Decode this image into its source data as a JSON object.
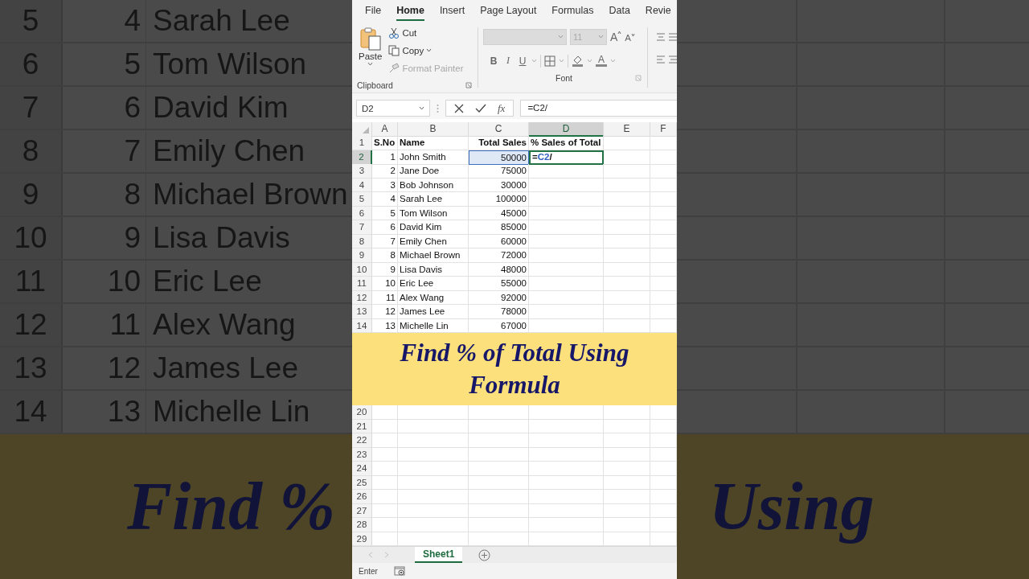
{
  "backdrop": {
    "rows": [
      {
        "row": "5",
        "sno": "4",
        "name": "Sarah Lee"
      },
      {
        "row": "6",
        "sno": "5",
        "name": "Tom Wilson"
      },
      {
        "row": "7",
        "sno": "6",
        "name": "David Kim"
      },
      {
        "row": "8",
        "sno": "7",
        "name": "Emily Chen"
      },
      {
        "row": "9",
        "sno": "8",
        "name": "Michael Brown"
      },
      {
        "row": "10",
        "sno": "9",
        "name": "Lisa Davis"
      },
      {
        "row": "11",
        "sno": "10",
        "name": "Eric Lee"
      },
      {
        "row": "12",
        "sno": "11",
        "name": "Alex Wang"
      },
      {
        "row": "13",
        "sno": "12",
        "name": "James Lee"
      },
      {
        "row": "14",
        "sno": "13",
        "name": "Michelle Lin"
      }
    ],
    "banner_left": "Find %",
    "banner_right": "Using"
  },
  "ribbon": {
    "tabs": [
      {
        "label": "File",
        "selected": false
      },
      {
        "label": "Home",
        "selected": true
      },
      {
        "label": "Insert",
        "selected": false
      },
      {
        "label": "Page Layout",
        "selected": false
      },
      {
        "label": "Formulas",
        "selected": false
      },
      {
        "label": "Data",
        "selected": false
      },
      {
        "label": "Revie",
        "selected": false
      }
    ],
    "clipboard": {
      "paste": "Paste",
      "items": [
        {
          "kind": "cut",
          "label": "Cut",
          "disabled": false
        },
        {
          "kind": "copy",
          "label": "Copy",
          "disabled": false
        },
        {
          "kind": "painter",
          "label": "Format Painter",
          "disabled": true
        }
      ],
      "group_label": "Clipboard"
    },
    "font": {
      "size": "11",
      "grow": "A",
      "shrink": "A",
      "bold": "B",
      "italic": "I",
      "underline": "U",
      "font_color": "A",
      "group_label": "Font"
    }
  },
  "formula_bar": {
    "name_box": "D2",
    "fx": "fx",
    "formula": "=C2/"
  },
  "sheet": {
    "columns": [
      {
        "letter": "A",
        "selected": false
      },
      {
        "letter": "B",
        "selected": false
      },
      {
        "letter": "C",
        "selected": false
      },
      {
        "letter": "D",
        "selected": true
      },
      {
        "letter": "E",
        "selected": false
      },
      {
        "letter": "F",
        "selected": false
      }
    ],
    "rows": [
      {
        "header": "1",
        "selected": false,
        "kind": "header",
        "cells": [
          {
            "text": "S.No",
            "kind": "text"
          },
          {
            "text": "Name",
            "kind": "text"
          },
          {
            "text": "Total Sales",
            "kind": "rightlabel"
          },
          {
            "text": "% Sales of Total",
            "kind": "text"
          }
        ]
      },
      {
        "header": "2",
        "selected": true,
        "kind": "data",
        "cells": [
          {
            "text": "1",
            "kind": "number"
          },
          {
            "text": "John Smith",
            "kind": "text"
          },
          {
            "text": "50000",
            "kind": "reference"
          },
          {
            "parts": [
              {
                "text": "=",
                "kind": "plain"
              },
              {
                "text": "C2",
                "kind": "reference"
              },
              {
                "text": "/",
                "kind": "plain"
              }
            ],
            "kind": "editing"
          }
        ]
      },
      {
        "header": "3",
        "selected": false,
        "kind": "data",
        "cells": [
          {
            "text": "2",
            "kind": "number"
          },
          {
            "text": "Jane Doe",
            "kind": "text"
          },
          {
            "text": "75000",
            "kind": "number"
          }
        ]
      },
      {
        "header": "4",
        "selected": false,
        "kind": "data",
        "cells": [
          {
            "text": "3",
            "kind": "number"
          },
          {
            "text": "Bob Johnson",
            "kind": "text"
          },
          {
            "text": "30000",
            "kind": "number"
          }
        ]
      },
      {
        "header": "5",
        "selected": false,
        "kind": "data",
        "cells": [
          {
            "text": "4",
            "kind": "number"
          },
          {
            "text": "Sarah Lee",
            "kind": "text"
          },
          {
            "text": "100000",
            "kind": "number"
          }
        ]
      },
      {
        "header": "6",
        "selected": false,
        "kind": "data",
        "cells": [
          {
            "text": "5",
            "kind": "number"
          },
          {
            "text": "Tom Wilson",
            "kind": "text"
          },
          {
            "text": "45000",
            "kind": "number"
          }
        ]
      },
      {
        "header": "7",
        "selected": false,
        "kind": "data",
        "cells": [
          {
            "text": "6",
            "kind": "number"
          },
          {
            "text": "David Kim",
            "kind": "text"
          },
          {
            "text": "85000",
            "kind": "number"
          }
        ]
      },
      {
        "header": "8",
        "selected": false,
        "kind": "data",
        "cells": [
          {
            "text": "7",
            "kind": "number"
          },
          {
            "text": "Emily Chen",
            "kind": "text"
          },
          {
            "text": "60000",
            "kind": "number"
          }
        ]
      },
      {
        "header": "9",
        "selected": false,
        "kind": "data",
        "cells": [
          {
            "text": "8",
            "kind": "number"
          },
          {
            "text": "Michael Brown",
            "kind": "text"
          },
          {
            "text": "72000",
            "kind": "number"
          }
        ]
      },
      {
        "header": "10",
        "selected": false,
        "kind": "data",
        "cells": [
          {
            "text": "9",
            "kind": "number"
          },
          {
            "text": "Lisa Davis",
            "kind": "text"
          },
          {
            "text": "48000",
            "kind": "number"
          }
        ]
      },
      {
        "header": "11",
        "selected": false,
        "kind": "data",
        "cells": [
          {
            "text": "10",
            "kind": "number"
          },
          {
            "text": "Eric Lee",
            "kind": "text"
          },
          {
            "text": "55000",
            "kind": "number"
          }
        ]
      },
      {
        "header": "12",
        "selected": false,
        "kind": "data",
        "cells": [
          {
            "text": "11",
            "kind": "number"
          },
          {
            "text": "Alex Wang",
            "kind": "text"
          },
          {
            "text": "92000",
            "kind": "number"
          }
        ]
      },
      {
        "header": "13",
        "selected": false,
        "kind": "data",
        "cells": [
          {
            "text": "12",
            "kind": "number"
          },
          {
            "text": "James Lee",
            "kind": "text"
          },
          {
            "text": "78000",
            "kind": "number"
          }
        ]
      },
      {
        "header": "14",
        "selected": false,
        "kind": "data",
        "cells": [
          {
            "text": "13",
            "kind": "number"
          },
          {
            "text": "Michelle Lin",
            "kind": "text"
          },
          {
            "text": "67000",
            "kind": "number"
          }
        ]
      }
    ],
    "caption": "Find % of Total Using Formula",
    "lower_rows": [
      "20",
      "21",
      "22",
      "23",
      "24",
      "25",
      "26",
      "27",
      "28",
      "29"
    ]
  },
  "sheet_tabs": [
    {
      "label": "Sheet1",
      "selected": true
    }
  ],
  "status_bar": {
    "mode": "Enter"
  }
}
